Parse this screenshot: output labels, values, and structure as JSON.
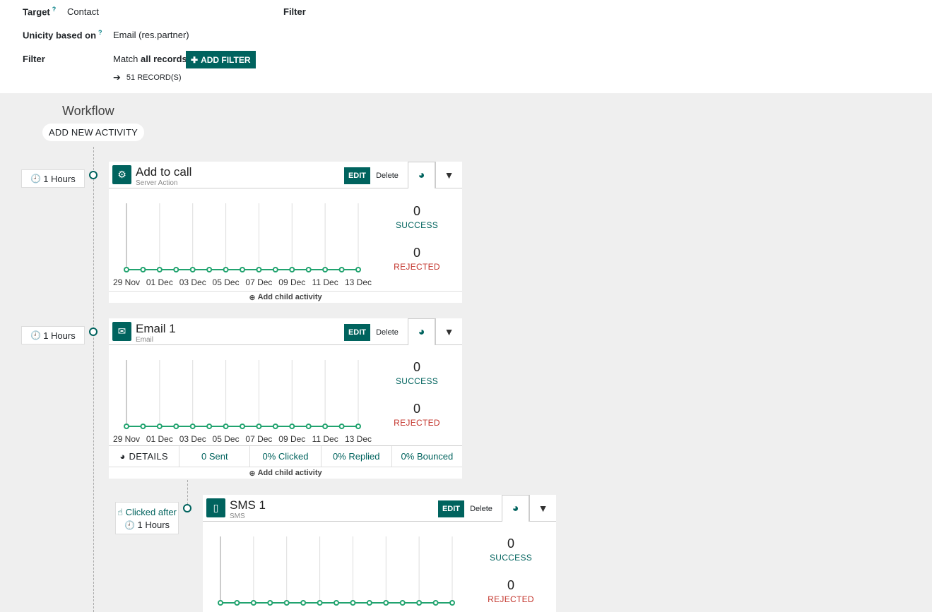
{
  "header": {
    "target_label": "Target",
    "target_help": "?",
    "target_value": "Contact",
    "filter_title": "Filter",
    "unicity_label": "Unicity based on",
    "unicity_help": "?",
    "unicity_value": "Email (res.partner)",
    "filter_label": "Filter",
    "match_prefix": "Match",
    "match_bold": "all records",
    "add_filter_label": "ADD FILTER",
    "records_label": "51 RECORD(S)"
  },
  "workflow": {
    "title": "Workflow",
    "add_activity_label": "ADD NEW ACTIVITY"
  },
  "common": {
    "edit_label": "EDIT",
    "delete_label": "Delete",
    "success_label": "SUCCESS",
    "rejected_label": "REJECTED",
    "add_child_label": "Add child activity",
    "time_label": "1 Hours"
  },
  "chart_dates": [
    "29 Nov",
    "01 Dec",
    "03 Dec",
    "05 Dec",
    "07 Dec",
    "09 Dec",
    "11 Dec",
    "13 Dec"
  ],
  "activities": [
    {
      "title": "Add to call",
      "subtitle": "Server Action",
      "icon": "gears-icon",
      "success": "0",
      "rejected": "0"
    },
    {
      "title": "Email 1",
      "subtitle": "Email",
      "icon": "envelope-icon",
      "success": "0",
      "rejected": "0",
      "details": {
        "details_label": "DETAILS",
        "sent": "0 Sent",
        "clicked": "0% Clicked",
        "replied": "0% Replied",
        "bounced": "0% Bounced"
      }
    },
    {
      "title": "SMS 1",
      "subtitle": "SMS",
      "icon": "mobile-icon",
      "success": "0",
      "rejected": "0",
      "trigger_label": "Clicked after"
    }
  ],
  "colors": {
    "primary": "#00635e",
    "success_line": "#21a36f",
    "rejected": "#c3342b"
  },
  "chart_data": [
    {
      "type": "line",
      "title": "",
      "x": [
        "29 Nov",
        "30 Nov",
        "01 Dec",
        "02 Dec",
        "03 Dec",
        "04 Dec",
        "05 Dec",
        "06 Dec",
        "07 Dec",
        "08 Dec",
        "09 Dec",
        "10 Dec",
        "11 Dec",
        "12 Dec",
        "13 Dec"
      ],
      "series": [
        {
          "values": [
            0,
            0,
            0,
            0,
            0,
            0,
            0,
            0,
            0,
            0,
            0,
            0,
            0,
            0,
            0
          ]
        }
      ]
    },
    {
      "type": "line",
      "title": "",
      "x": [
        "29 Nov",
        "30 Nov",
        "01 Dec",
        "02 Dec",
        "03 Dec",
        "04 Dec",
        "05 Dec",
        "06 Dec",
        "07 Dec",
        "08 Dec",
        "09 Dec",
        "10 Dec",
        "11 Dec",
        "12 Dec",
        "13 Dec"
      ],
      "series": [
        {
          "values": [
            0,
            0,
            0,
            0,
            0,
            0,
            0,
            0,
            0,
            0,
            0,
            0,
            0,
            0,
            0
          ]
        }
      ]
    },
    {
      "type": "line",
      "title": "",
      "x": [
        "29 Nov",
        "30 Nov",
        "01 Dec",
        "02 Dec",
        "03 Dec",
        "04 Dec",
        "05 Dec",
        "06 Dec",
        "07 Dec",
        "08 Dec",
        "09 Dec",
        "10 Dec",
        "11 Dec",
        "12 Dec",
        "13 Dec"
      ],
      "series": [
        {
          "values": [
            0,
            0,
            0,
            0,
            0,
            0,
            0,
            0,
            0,
            0,
            0,
            0,
            0,
            0,
            0
          ]
        }
      ]
    }
  ]
}
